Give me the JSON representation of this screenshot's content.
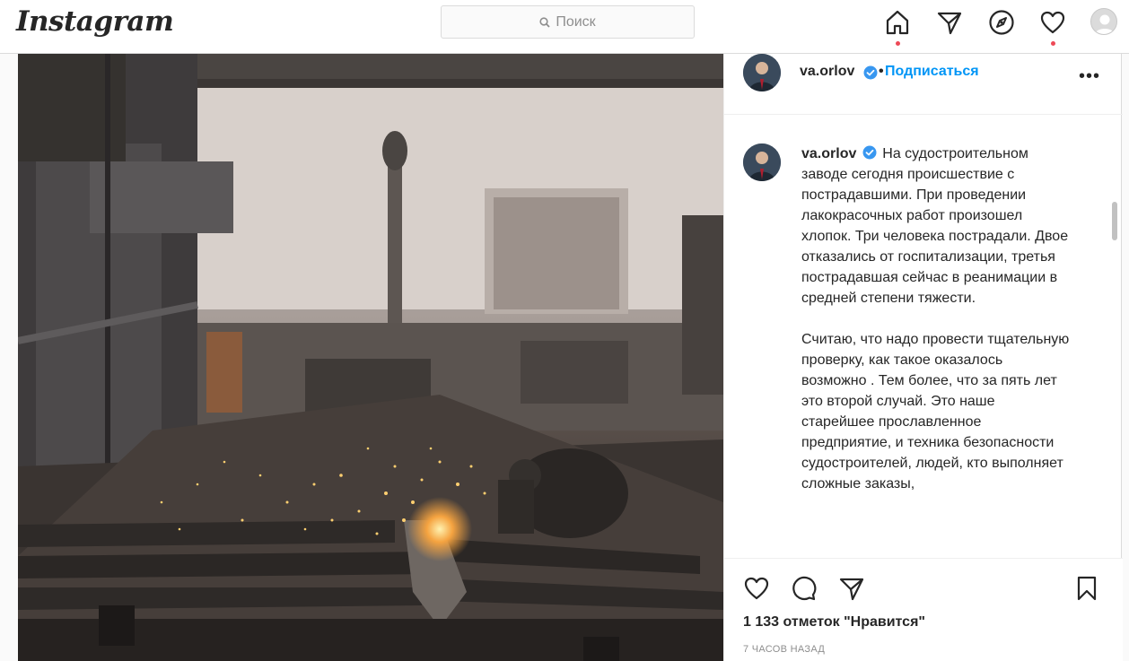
{
  "nav": {
    "logo": "Instagram",
    "search_placeholder": "Поиск"
  },
  "post": {
    "author": {
      "username": "va.orlov",
      "verified": true
    },
    "follow_label": "Подписаться",
    "separator": "•",
    "more_label": "•••",
    "caption": [
      "На судостроительном заводе сегодня происшествие с пострадавшими. При проведении лакокрасочных работ произошел хлопок. Три человека пострадали. Двое отказались от госпитализации, третья пострадавшая сейчас в реанимации в средней степени тяжести.",
      "Считаю, что надо провести тщательную проверку, как такое оказалось возможно . Тем более, что за пять лет это второй случай. Это наше старейшее прославленное предприятие, и техника безопасности судостроителей, людей, кто выполняет сложные заказы,"
    ],
    "likes": "1 133 отметок \"Нравится\"",
    "timestamp": "7 ЧАСОВ НАЗАД"
  },
  "colors": {
    "accent": "#0095f6",
    "notification_dot": "#ed4956",
    "verified": "#3897f0"
  },
  "icons": [
    "home-icon",
    "direct-icon",
    "explore-icon",
    "activity-heart-icon",
    "profile-avatar",
    "search-icon",
    "verified-badge-icon",
    "more-options-icon",
    "like-heart-icon",
    "comment-icon",
    "share-icon",
    "save-bookmark-icon"
  ]
}
